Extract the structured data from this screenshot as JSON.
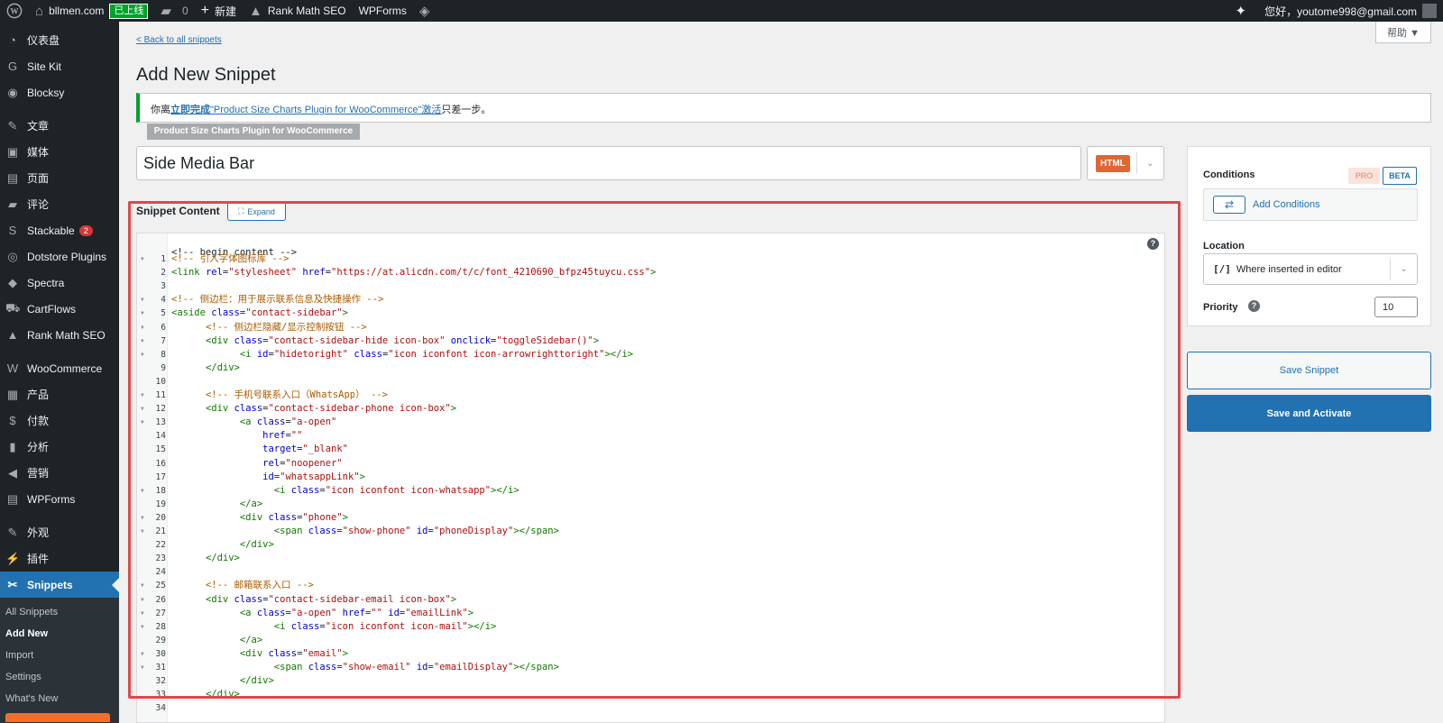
{
  "adminbar": {
    "site_name": "bllmen.com",
    "live_badge": "已上线",
    "comments_count": "0",
    "new_label": "新建",
    "rank_math": "Rank Math SEO",
    "wpforms": "WPForms",
    "greeting": "您好，youtome998@gmail.com"
  },
  "sidebar": {
    "items": [
      {
        "label": "仪表盘",
        "icon": "dashboard-icon",
        "glyph": "◔"
      },
      {
        "label": "Site Kit",
        "icon": "site-kit-icon",
        "glyph": "G"
      },
      {
        "label": "Blocksy",
        "icon": "blocksy-icon",
        "glyph": "◉"
      },
      {
        "label": "文章",
        "icon": "pin-icon",
        "glyph": "✎"
      },
      {
        "label": "媒体",
        "icon": "media-icon",
        "glyph": "▣"
      },
      {
        "label": "页面",
        "icon": "page-icon",
        "glyph": "▤"
      },
      {
        "label": "评论",
        "icon": "comment-icon",
        "glyph": "▰"
      },
      {
        "label": "Stackable",
        "icon": "stackable-icon",
        "glyph": "S",
        "badge": "2"
      },
      {
        "label": "Dotstore Plugins",
        "icon": "dotstore-icon",
        "glyph": "◎"
      },
      {
        "label": "Spectra",
        "icon": "spectra-icon",
        "glyph": "◆"
      },
      {
        "label": "CartFlows",
        "icon": "cartflows-icon",
        "glyph": "⛟"
      },
      {
        "label": "Rank Math SEO",
        "icon": "rank-math-icon",
        "glyph": "▲"
      },
      {
        "label": "WooCommerce",
        "icon": "woo-icon",
        "glyph": "W"
      },
      {
        "label": "产品",
        "icon": "products-icon",
        "glyph": "▦"
      },
      {
        "label": "付款",
        "icon": "payments-icon",
        "glyph": "$"
      },
      {
        "label": "分析",
        "icon": "analytics-icon",
        "glyph": "▮"
      },
      {
        "label": "营销",
        "icon": "marketing-icon",
        "glyph": "◀"
      },
      {
        "label": "WPForms",
        "icon": "wpforms-icon",
        "glyph": "▤"
      },
      {
        "label": "外观",
        "icon": "appearance-icon",
        "glyph": "✎"
      },
      {
        "label": "插件",
        "icon": "plugins-icon",
        "glyph": "⚡"
      },
      {
        "label": "Snippets",
        "icon": "snippets-icon",
        "glyph": "✂"
      }
    ],
    "submenu": [
      "All Snippets",
      "Add New",
      "Import",
      "Settings",
      "What's New"
    ]
  },
  "header": {
    "back_link": "< Back to all snippets",
    "help": "帮助 ▼",
    "title": "Add New Snippet"
  },
  "notice": {
    "prefix": "你离",
    "link1": "立即完成",
    "plugin_link": "\"Product Size Charts Plugin for WooCommerce\"激活",
    "suffix": "只差一步。",
    "tag": "Product Size Charts Plugin for WooCommerce"
  },
  "snippet": {
    "title_value": "Side Media Bar",
    "type": "HTML",
    "content_label": "Snippet Content",
    "expand_label": "Expand"
  },
  "editor": {
    "faded_top": "<!-- begin content -->",
    "lines": [
      {
        "n": "1",
        "fold": true,
        "parts": [
          {
            "t": "<!-- 引入字体图标库 -->",
            "c": "comment"
          }
        ]
      },
      {
        "n": "2",
        "fold": false,
        "parts": [
          {
            "t": "<link ",
            "c": "tag"
          },
          {
            "t": "rel",
            "c": "attr"
          },
          {
            "t": "=",
            "c": ""
          },
          {
            "t": "\"stylesheet\"",
            "c": "str"
          },
          {
            "t": " href",
            "c": "attr"
          },
          {
            "t": "=",
            "c": ""
          },
          {
            "t": "\"https://at.alicdn.com/t/c/font_4210690_bfpz45tuycu.css\"",
            "c": "str"
          },
          {
            "t": ">",
            "c": "tag"
          }
        ]
      },
      {
        "n": "3",
        "fold": false,
        "parts": []
      },
      {
        "n": "4",
        "fold": true,
        "parts": [
          {
            "t": "<!-- 侧边栏：用于展示联系信息及快捷操作 -->",
            "c": "comment"
          }
        ]
      },
      {
        "n": "5",
        "fold": true,
        "parts": [
          {
            "t": "<aside ",
            "c": "tag"
          },
          {
            "t": "class",
            "c": "attr"
          },
          {
            "t": "=",
            "c": ""
          },
          {
            "t": "\"contact-sidebar\"",
            "c": "str"
          },
          {
            "t": ">",
            "c": "tag"
          }
        ]
      },
      {
        "n": "6",
        "fold": true,
        "parts": [
          {
            "t": "      ",
            "c": ""
          },
          {
            "t": "<!-- 侧边栏隐藏/显示控制按钮 -->",
            "c": "comment"
          }
        ]
      },
      {
        "n": "7",
        "fold": true,
        "parts": [
          {
            "t": "      ",
            "c": ""
          },
          {
            "t": "<div ",
            "c": "tag"
          },
          {
            "t": "class",
            "c": "attr"
          },
          {
            "t": "=",
            "c": ""
          },
          {
            "t": "\"contact-sidebar-hide icon-box\"",
            "c": "str"
          },
          {
            "t": " onclick",
            "c": "attr"
          },
          {
            "t": "=",
            "c": ""
          },
          {
            "t": "\"toggleSidebar()\"",
            "c": "str"
          },
          {
            "t": ">",
            "c": "tag"
          }
        ]
      },
      {
        "n": "8",
        "fold": true,
        "parts": [
          {
            "t": "            ",
            "c": ""
          },
          {
            "t": "<i ",
            "c": "tag"
          },
          {
            "t": "id",
            "c": "attr"
          },
          {
            "t": "=",
            "c": ""
          },
          {
            "t": "\"hidetoright\"",
            "c": "str"
          },
          {
            "t": " class",
            "c": "attr"
          },
          {
            "t": "=",
            "c": ""
          },
          {
            "t": "\"icon iconfont icon-arrowrighttoright\"",
            "c": "str"
          },
          {
            "t": "></i>",
            "c": "tag"
          }
        ]
      },
      {
        "n": "9",
        "fold": false,
        "parts": [
          {
            "t": "      ",
            "c": ""
          },
          {
            "t": "</div>",
            "c": "tag"
          }
        ]
      },
      {
        "n": "10",
        "fold": false,
        "parts": []
      },
      {
        "n": "11",
        "fold": true,
        "parts": [
          {
            "t": "      ",
            "c": ""
          },
          {
            "t": "<!-- 手机号联系入口（WhatsApp） -->",
            "c": "comment"
          }
        ]
      },
      {
        "n": "12",
        "fold": true,
        "parts": [
          {
            "t": "      ",
            "c": ""
          },
          {
            "t": "<div ",
            "c": "tag"
          },
          {
            "t": "class",
            "c": "attr"
          },
          {
            "t": "=",
            "c": ""
          },
          {
            "t": "\"contact-sidebar-phone icon-box\"",
            "c": "str"
          },
          {
            "t": ">",
            "c": "tag"
          }
        ]
      },
      {
        "n": "13",
        "fold": true,
        "parts": [
          {
            "t": "            ",
            "c": ""
          },
          {
            "t": "<a ",
            "c": "tag"
          },
          {
            "t": "class",
            "c": "attr"
          },
          {
            "t": "=",
            "c": ""
          },
          {
            "t": "\"a-open\"",
            "c": "str"
          }
        ]
      },
      {
        "n": "14",
        "fold": false,
        "parts": [
          {
            "t": "                ",
            "c": ""
          },
          {
            "t": "href",
            "c": "attr"
          },
          {
            "t": "=",
            "c": ""
          },
          {
            "t": "\"\"",
            "c": "str"
          }
        ]
      },
      {
        "n": "15",
        "fold": false,
        "parts": [
          {
            "t": "                ",
            "c": ""
          },
          {
            "t": "target",
            "c": "attr"
          },
          {
            "t": "=",
            "c": ""
          },
          {
            "t": "\"_blank\"",
            "c": "str"
          }
        ]
      },
      {
        "n": "16",
        "fold": false,
        "parts": [
          {
            "t": "                ",
            "c": ""
          },
          {
            "t": "rel",
            "c": "attr"
          },
          {
            "t": "=",
            "c": ""
          },
          {
            "t": "\"noopener\"",
            "c": "str"
          }
        ]
      },
      {
        "n": "17",
        "fold": false,
        "parts": [
          {
            "t": "                ",
            "c": ""
          },
          {
            "t": "id",
            "c": "attr"
          },
          {
            "t": "=",
            "c": ""
          },
          {
            "t": "\"whatsappLink\"",
            "c": "str"
          },
          {
            "t": ">",
            "c": "tag"
          }
        ]
      },
      {
        "n": "18",
        "fold": true,
        "parts": [
          {
            "t": "                  ",
            "c": ""
          },
          {
            "t": "<i ",
            "c": "tag"
          },
          {
            "t": "class",
            "c": "attr"
          },
          {
            "t": "=",
            "c": ""
          },
          {
            "t": "\"icon iconfont icon-whatsapp\"",
            "c": "str"
          },
          {
            "t": "></i>",
            "c": "tag"
          }
        ]
      },
      {
        "n": "19",
        "fold": false,
        "parts": [
          {
            "t": "            ",
            "c": ""
          },
          {
            "t": "</a>",
            "c": "tag"
          }
        ]
      },
      {
        "n": "20",
        "fold": true,
        "parts": [
          {
            "t": "            ",
            "c": ""
          },
          {
            "t": "<div ",
            "c": "tag"
          },
          {
            "t": "class",
            "c": "attr"
          },
          {
            "t": "=",
            "c": ""
          },
          {
            "t": "\"phone\"",
            "c": "str"
          },
          {
            "t": ">",
            "c": "tag"
          }
        ]
      },
      {
        "n": "21",
        "fold": true,
        "parts": [
          {
            "t": "                  ",
            "c": ""
          },
          {
            "t": "<span ",
            "c": "tag"
          },
          {
            "t": "class",
            "c": "attr"
          },
          {
            "t": "=",
            "c": ""
          },
          {
            "t": "\"show-phone\"",
            "c": "str"
          },
          {
            "t": " id",
            "c": "attr"
          },
          {
            "t": "=",
            "c": ""
          },
          {
            "t": "\"phoneDisplay\"",
            "c": "str"
          },
          {
            "t": "></span>",
            "c": "tag"
          }
        ]
      },
      {
        "n": "22",
        "fold": false,
        "parts": [
          {
            "t": "            ",
            "c": ""
          },
          {
            "t": "</div>",
            "c": "tag"
          }
        ]
      },
      {
        "n": "23",
        "fold": false,
        "parts": [
          {
            "t": "      ",
            "c": ""
          },
          {
            "t": "</div>",
            "c": "tag"
          }
        ]
      },
      {
        "n": "24",
        "fold": false,
        "parts": []
      },
      {
        "n": "25",
        "fold": true,
        "parts": [
          {
            "t": "      ",
            "c": ""
          },
          {
            "t": "<!-- 邮箱联系入口 -->",
            "c": "comment"
          }
        ]
      },
      {
        "n": "26",
        "fold": true,
        "parts": [
          {
            "t": "      ",
            "c": ""
          },
          {
            "t": "<div ",
            "c": "tag"
          },
          {
            "t": "class",
            "c": "attr"
          },
          {
            "t": "=",
            "c": ""
          },
          {
            "t": "\"contact-sidebar-email icon-box\"",
            "c": "str"
          },
          {
            "t": ">",
            "c": "tag"
          }
        ]
      },
      {
        "n": "27",
        "fold": true,
        "parts": [
          {
            "t": "            ",
            "c": ""
          },
          {
            "t": "<a ",
            "c": "tag"
          },
          {
            "t": "class",
            "c": "attr"
          },
          {
            "t": "=",
            "c": ""
          },
          {
            "t": "\"a-open\"",
            "c": "str"
          },
          {
            "t": " href",
            "c": "attr"
          },
          {
            "t": "=",
            "c": ""
          },
          {
            "t": "\"\"",
            "c": "str"
          },
          {
            "t": " id",
            "c": "attr"
          },
          {
            "t": "=",
            "c": ""
          },
          {
            "t": "\"emailLink\"",
            "c": "str"
          },
          {
            "t": ">",
            "c": "tag"
          }
        ]
      },
      {
        "n": "28",
        "fold": true,
        "parts": [
          {
            "t": "                  ",
            "c": ""
          },
          {
            "t": "<i ",
            "c": "tag"
          },
          {
            "t": "class",
            "c": "attr"
          },
          {
            "t": "=",
            "c": ""
          },
          {
            "t": "\"icon iconfont icon-mail\"",
            "c": "str"
          },
          {
            "t": "></i>",
            "c": "tag"
          }
        ]
      },
      {
        "n": "29",
        "fold": false,
        "parts": [
          {
            "t": "            ",
            "c": ""
          },
          {
            "t": "</a>",
            "c": "tag"
          }
        ]
      },
      {
        "n": "30",
        "fold": true,
        "parts": [
          {
            "t": "            ",
            "c": ""
          },
          {
            "t": "<div ",
            "c": "tag"
          },
          {
            "t": "class",
            "c": "attr"
          },
          {
            "t": "=",
            "c": ""
          },
          {
            "t": "\"email\"",
            "c": "str"
          },
          {
            "t": ">",
            "c": "tag"
          }
        ]
      },
      {
        "n": "31",
        "fold": true,
        "parts": [
          {
            "t": "                  ",
            "c": ""
          },
          {
            "t": "<span ",
            "c": "tag"
          },
          {
            "t": "class",
            "c": "attr"
          },
          {
            "t": "=",
            "c": ""
          },
          {
            "t": "\"show-email\"",
            "c": "str"
          },
          {
            "t": " id",
            "c": "attr"
          },
          {
            "t": "=",
            "c": ""
          },
          {
            "t": "\"emailDisplay\"",
            "c": "str"
          },
          {
            "t": "></span>",
            "c": "tag"
          }
        ]
      },
      {
        "n": "32",
        "fold": false,
        "parts": [
          {
            "t": "            ",
            "c": ""
          },
          {
            "t": "</div>",
            "c": "tag"
          }
        ]
      },
      {
        "n": "33",
        "fold": false,
        "parts": [
          {
            "t": "      ",
            "c": ""
          },
          {
            "t": "</div>",
            "c": "tag"
          }
        ]
      },
      {
        "n": "34",
        "fold": false,
        "parts": []
      }
    ]
  },
  "sidepanel": {
    "conditions_label": "Conditions",
    "pro_badge": "PRO",
    "beta_badge": "BETA",
    "add_conditions": "Add Conditions",
    "location_label": "Location",
    "location_icon": "[/]",
    "location_value": "Where inserted in editor",
    "priority_label": "Priority",
    "priority_value": "10",
    "save_label": "Save Snippet",
    "save_activate_label": "Save and Activate"
  },
  "colors": {
    "accent": "#2271b1",
    "highlight_border": "#e04848",
    "html_badge": "#e06632",
    "notice_border": "#00a32a"
  }
}
